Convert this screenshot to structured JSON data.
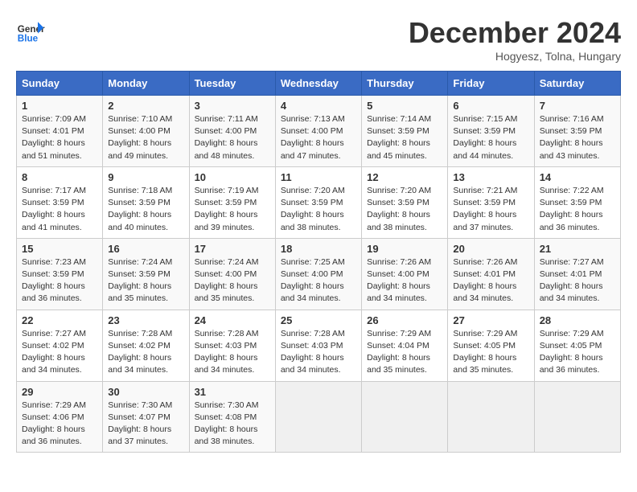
{
  "header": {
    "logo_line1": "General",
    "logo_line2": "Blue",
    "month": "December 2024",
    "location": "Hogyesz, Tolna, Hungary"
  },
  "days_of_week": [
    "Sunday",
    "Monday",
    "Tuesday",
    "Wednesday",
    "Thursday",
    "Friday",
    "Saturday"
  ],
  "weeks": [
    [
      {
        "day": 1,
        "info": "Sunrise: 7:09 AM\nSunset: 4:01 PM\nDaylight: 8 hours\nand 51 minutes."
      },
      {
        "day": 2,
        "info": "Sunrise: 7:10 AM\nSunset: 4:00 PM\nDaylight: 8 hours\nand 49 minutes."
      },
      {
        "day": 3,
        "info": "Sunrise: 7:11 AM\nSunset: 4:00 PM\nDaylight: 8 hours\nand 48 minutes."
      },
      {
        "day": 4,
        "info": "Sunrise: 7:13 AM\nSunset: 4:00 PM\nDaylight: 8 hours\nand 47 minutes."
      },
      {
        "day": 5,
        "info": "Sunrise: 7:14 AM\nSunset: 3:59 PM\nDaylight: 8 hours\nand 45 minutes."
      },
      {
        "day": 6,
        "info": "Sunrise: 7:15 AM\nSunset: 3:59 PM\nDaylight: 8 hours\nand 44 minutes."
      },
      {
        "day": 7,
        "info": "Sunrise: 7:16 AM\nSunset: 3:59 PM\nDaylight: 8 hours\nand 43 minutes."
      }
    ],
    [
      {
        "day": 8,
        "info": "Sunrise: 7:17 AM\nSunset: 3:59 PM\nDaylight: 8 hours\nand 41 minutes."
      },
      {
        "day": 9,
        "info": "Sunrise: 7:18 AM\nSunset: 3:59 PM\nDaylight: 8 hours\nand 40 minutes."
      },
      {
        "day": 10,
        "info": "Sunrise: 7:19 AM\nSunset: 3:59 PM\nDaylight: 8 hours\nand 39 minutes."
      },
      {
        "day": 11,
        "info": "Sunrise: 7:20 AM\nSunset: 3:59 PM\nDaylight: 8 hours\nand 38 minutes."
      },
      {
        "day": 12,
        "info": "Sunrise: 7:20 AM\nSunset: 3:59 PM\nDaylight: 8 hours\nand 38 minutes."
      },
      {
        "day": 13,
        "info": "Sunrise: 7:21 AM\nSunset: 3:59 PM\nDaylight: 8 hours\nand 37 minutes."
      },
      {
        "day": 14,
        "info": "Sunrise: 7:22 AM\nSunset: 3:59 PM\nDaylight: 8 hours\nand 36 minutes."
      }
    ],
    [
      {
        "day": 15,
        "info": "Sunrise: 7:23 AM\nSunset: 3:59 PM\nDaylight: 8 hours\nand 36 minutes."
      },
      {
        "day": 16,
        "info": "Sunrise: 7:24 AM\nSunset: 3:59 PM\nDaylight: 8 hours\nand 35 minutes."
      },
      {
        "day": 17,
        "info": "Sunrise: 7:24 AM\nSunset: 4:00 PM\nDaylight: 8 hours\nand 35 minutes."
      },
      {
        "day": 18,
        "info": "Sunrise: 7:25 AM\nSunset: 4:00 PM\nDaylight: 8 hours\nand 34 minutes."
      },
      {
        "day": 19,
        "info": "Sunrise: 7:26 AM\nSunset: 4:00 PM\nDaylight: 8 hours\nand 34 minutes."
      },
      {
        "day": 20,
        "info": "Sunrise: 7:26 AM\nSunset: 4:01 PM\nDaylight: 8 hours\nand 34 minutes."
      },
      {
        "day": 21,
        "info": "Sunrise: 7:27 AM\nSunset: 4:01 PM\nDaylight: 8 hours\nand 34 minutes."
      }
    ],
    [
      {
        "day": 22,
        "info": "Sunrise: 7:27 AM\nSunset: 4:02 PM\nDaylight: 8 hours\nand 34 minutes."
      },
      {
        "day": 23,
        "info": "Sunrise: 7:28 AM\nSunset: 4:02 PM\nDaylight: 8 hours\nand 34 minutes."
      },
      {
        "day": 24,
        "info": "Sunrise: 7:28 AM\nSunset: 4:03 PM\nDaylight: 8 hours\nand 34 minutes."
      },
      {
        "day": 25,
        "info": "Sunrise: 7:28 AM\nSunset: 4:03 PM\nDaylight: 8 hours\nand 34 minutes."
      },
      {
        "day": 26,
        "info": "Sunrise: 7:29 AM\nSunset: 4:04 PM\nDaylight: 8 hours\nand 35 minutes."
      },
      {
        "day": 27,
        "info": "Sunrise: 7:29 AM\nSunset: 4:05 PM\nDaylight: 8 hours\nand 35 minutes."
      },
      {
        "day": 28,
        "info": "Sunrise: 7:29 AM\nSunset: 4:05 PM\nDaylight: 8 hours\nand 36 minutes."
      }
    ],
    [
      {
        "day": 29,
        "info": "Sunrise: 7:29 AM\nSunset: 4:06 PM\nDaylight: 8 hours\nand 36 minutes."
      },
      {
        "day": 30,
        "info": "Sunrise: 7:30 AM\nSunset: 4:07 PM\nDaylight: 8 hours\nand 37 minutes."
      },
      {
        "day": 31,
        "info": "Sunrise: 7:30 AM\nSunset: 4:08 PM\nDaylight: 8 hours\nand 38 minutes."
      },
      null,
      null,
      null,
      null
    ]
  ]
}
